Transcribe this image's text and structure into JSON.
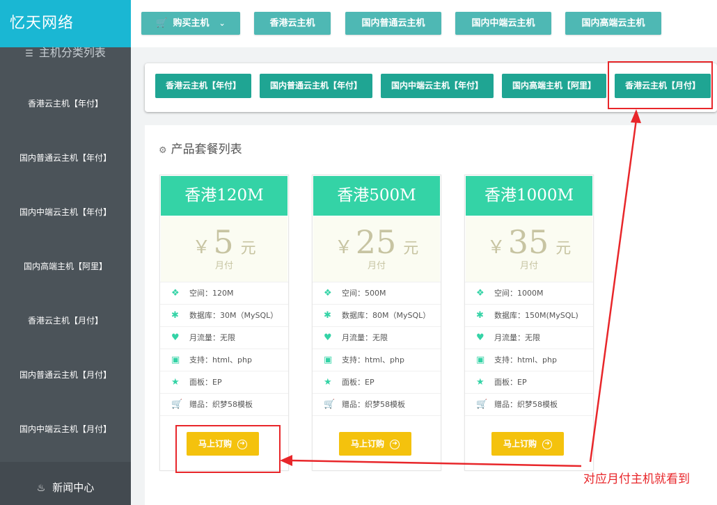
{
  "brand": "忆天网络",
  "sidebar": {
    "category_heading": "主机分类列表",
    "items": [
      {
        "label": "香港云主机【年付】"
      },
      {
        "label": "国内普通云主机【年付】"
      },
      {
        "label": "国内中端云主机【年付】"
      },
      {
        "label": "国内高端主机【阿里】"
      },
      {
        "label": "香港云主机【月付】"
      },
      {
        "label": "国内普通云主机【月付】"
      },
      {
        "label": "国内中端云主机【月付】"
      }
    ],
    "footer": "新闻中心"
  },
  "topnav": {
    "buy_label": "购买主机",
    "tabs": [
      {
        "label": "香港云主机"
      },
      {
        "label": "国内普通云主机"
      },
      {
        "label": "国内中端云主机"
      },
      {
        "label": "国内高端云主机"
      }
    ]
  },
  "subcats": [
    {
      "label": "香港云主机【年付】"
    },
    {
      "label": "国内普通云主机【年付】"
    },
    {
      "label": "国内中端云主机【年付】"
    },
    {
      "label": "国内高端主机【阿里】"
    },
    {
      "label": "香港云主机【月付】"
    }
  ],
  "products_title": "产品套餐列表",
  "currency": "￥",
  "unit": "元",
  "buy_button": "马上订购",
  "plans": [
    {
      "name": "香港120M",
      "price": "5",
      "period": "月付",
      "features": [
        "空间：120M",
        "数据库：30M（MySQL）",
        "月流量：无限",
        "支持：html、php",
        "面板：EP",
        "赠品：织梦58模板"
      ]
    },
    {
      "name": "香港500M",
      "price": "25",
      "period": "月付",
      "features": [
        "空间：500M",
        "数据库：80M（MySQL）",
        "月流量：无限",
        "支持：html、php",
        "面板：EP",
        "赠品：织梦58模板"
      ]
    },
    {
      "name": "香港1000M",
      "price": "35",
      "period": "月付",
      "features": [
        "空间：1000M",
        "数据库：150M(MySQL)",
        "月流量：无限",
        "支持：html、php",
        "面板：EP",
        "赠品：织梦58模板"
      ]
    }
  ],
  "annotation": "对应月付主机就看到",
  "colors": {
    "brand": "#1ab7d3",
    "sidebar": "#4b5359",
    "nav_button": "#4eb8b4",
    "subcat_button": "#1fa593",
    "card_head": "#34d3a6",
    "buy": "#f4c20d",
    "annotation": "#e8262a"
  },
  "icons": {
    "category": "layers-icon",
    "footer": "bell-icon",
    "buy_nav": "cart-icon",
    "title": "gears-icon",
    "features": [
      "tags-icon",
      "asterisk-icon",
      "heart-icon",
      "html5-icon",
      "star-icon",
      "cart-icon"
    ]
  }
}
